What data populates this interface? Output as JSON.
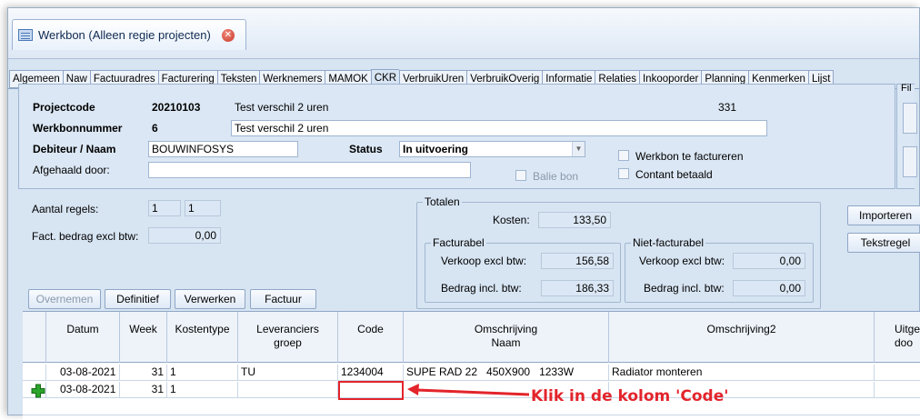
{
  "doc_tab": {
    "title": "Werkbon (Alleen regie projecten)"
  },
  "tabs": [
    {
      "label": "Algemeen"
    },
    {
      "label": "Naw"
    },
    {
      "label": "Factuuradres"
    },
    {
      "label": "Facturering"
    },
    {
      "label": "Teksten"
    },
    {
      "label": "Werknemers"
    },
    {
      "label": "MAMOK"
    },
    {
      "label": "CKR"
    },
    {
      "label": "VerbruikUren"
    },
    {
      "label": "VerbruikOverig"
    },
    {
      "label": "Informatie"
    },
    {
      "label": "Relaties"
    },
    {
      "label": "Inkooporder"
    },
    {
      "label": "Planning"
    },
    {
      "label": "Kenmerken"
    },
    {
      "label": "Lijst"
    }
  ],
  "header": {
    "projectcode_label": "Projectcode",
    "projectcode_value": "20210103",
    "project_desc": "Test verschil 2 uren",
    "project_number": "331",
    "werkbonnummer_label": "Werkbonnummer",
    "werkbonnummer_value": "6",
    "werkbon_desc": "Test verschil 2 uren",
    "debiteur_label": "Debiteur / Naam",
    "debiteur_value": "BOUWINFOSYS",
    "status_label": "Status",
    "status_value": "In uitvoering",
    "afgehaald_label": "Afgehaald door:",
    "afgehaald_value": "",
    "balie_label": "Balie bon",
    "werkbon_factureren_label": "Werkbon te factureren",
    "contant_label": "Contant betaald",
    "filter_fragment": "Fil"
  },
  "summary": {
    "aantal_label": "Aantal regels:",
    "aantal_1": "1",
    "aantal_2": "1",
    "fact_label": "Fact. bedrag excl btw:",
    "fact_value": "0,00"
  },
  "totalen": {
    "title": "Totalen",
    "kosten_label": "Kosten:",
    "kosten_value": "133,50",
    "facturabel_title": "Facturabel",
    "verkoop_label": "Verkoop excl btw:",
    "verkoop_value": "156,58",
    "bedrag_label": "Bedrag incl. btw:",
    "bedrag_value": "186,33",
    "niet_title": "Niet-facturabel",
    "niet_verkoop_label": "Verkoop excl btw:",
    "niet_verkoop_value": "0,00",
    "niet_bedrag_label": "Bedrag incl. btw:",
    "niet_bedrag_value": "0,00"
  },
  "side_buttons": {
    "importeren": "Importeren",
    "tekstregel": "Tekstregel"
  },
  "actions": {
    "overnemen": "Overnemen",
    "definitief": "Definitief",
    "verwerken": "Verwerken",
    "factuur": "Factuur"
  },
  "grid": {
    "columns": {
      "datum": "Datum",
      "week": "Week",
      "kostentype": "Kostentype",
      "leveranciers": "Leveranciers",
      "leveranciers_2": "groep",
      "code": "Code",
      "omschrijving": "Omschrijving",
      "omschrijving_2": "Naam",
      "omschrijving2": "Omschrijving2",
      "uitgevoerd": "Uitgevo",
      "uitgevoerd_2": "doo"
    },
    "rows": [
      {
        "datum": "03-08-2021",
        "week": "31",
        "kostentype": "1",
        "leveranciers": "TU",
        "code": "1234004",
        "omschrijving": "SUPE RAD 22   450X900   1233W",
        "omschrijving2": "Radiator monteren"
      },
      {
        "datum": "03-08-2021",
        "week": "31",
        "kostentype": "1",
        "leveranciers": "",
        "code": "",
        "omschrijving": "",
        "omschrijving2": ""
      }
    ]
  },
  "annotation": {
    "text": "Klik in de kolom 'Code'"
  },
  "colors": {
    "accent_red": "#e3242b",
    "panel_bg": "#d7e4f2",
    "add_green": "#2aa32a"
  }
}
